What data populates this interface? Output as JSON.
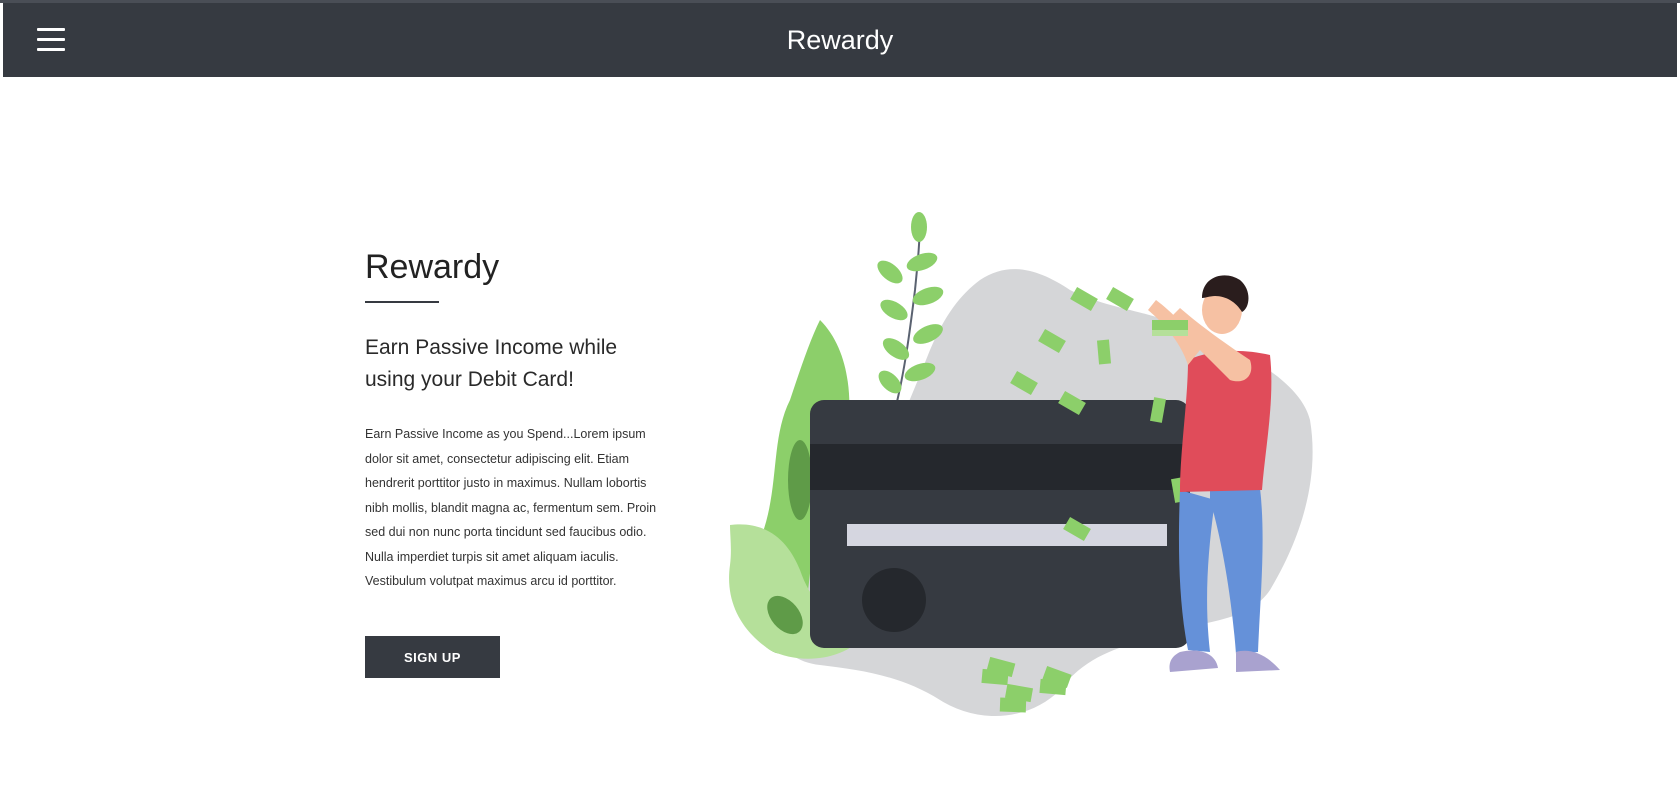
{
  "navbar": {
    "title": "Rewardy",
    "menu_icon": "hamburger-menu-icon"
  },
  "hero": {
    "title": "Rewardy",
    "subtitle": "Earn Passive Income while using your Debit Card!",
    "body": "Earn Passive Income as you Spend...Lorem ipsum dolor sit amet, consectetur adipiscing elit. Etiam hendrerit porttitor justo in maximus. Nullam lobortis nibh mollis, blandit magna ac, fermentum sem. Proin sed dui non nunc porta tincidunt sed faucibus odio. Nulla imperdiet turpis sit amet aliquam iaculis. Vestibulum volutpat maximus arcu id porttitor.",
    "signup_label": "SIGN UP"
  },
  "illustration": {
    "description_icon": "person-with-debit-card-and-money-illustration"
  },
  "colors": {
    "navbar": "#363a41",
    "card": "#363a41",
    "leaf_green": "#8ccf6a",
    "shirt": "#e04c5a",
    "jeans": "#6591d9",
    "blob": "#d5d6d8"
  }
}
